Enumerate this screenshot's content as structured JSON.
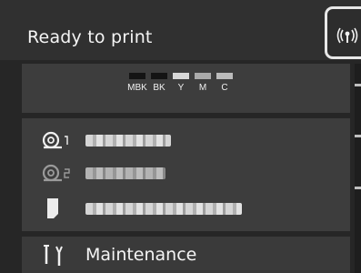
{
  "status": {
    "title": "Ready to print"
  },
  "network": {
    "icon": "wifi-icon"
  },
  "inks": [
    {
      "label": "MBK",
      "color": "#141414"
    },
    {
      "label": "BK",
      "color": "#141414"
    },
    {
      "label": "Y",
      "color": "#d8d8d8"
    },
    {
      "label": "M",
      "color": "#aaaaaa"
    },
    {
      "label": "C",
      "color": "#bbbbbb"
    }
  ],
  "media": [
    {
      "icon": "roll-1-icon"
    },
    {
      "icon": "roll-2-icon"
    },
    {
      "icon": "cut-sheet-icon"
    }
  ],
  "maintenance": {
    "label": "Maintenance",
    "icon": "maintenance-icon"
  }
}
